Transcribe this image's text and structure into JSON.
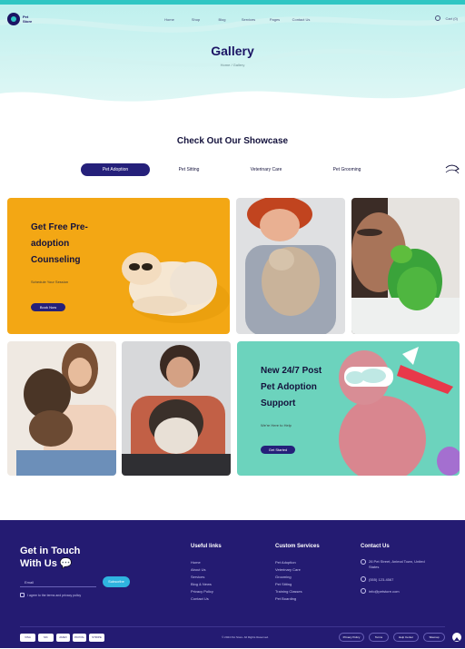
{
  "header": {
    "logo_text": "Pet Store",
    "menu": [
      "Home",
      "Shop",
      "Blog",
      "Services",
      "Pages",
      "Contact Us"
    ],
    "cart_label": "Cart (0)"
  },
  "hero": {
    "title": "Gallery",
    "breadcrumb": "Home / Gallery"
  },
  "showcase": {
    "title": "Check Out Our Showcase",
    "tabs": [
      "Pet Adoption",
      "Pet Sitting",
      "Veterinary Care",
      "Pet Grooming"
    ],
    "active_tab": 0
  },
  "promo1": {
    "title_lines": [
      "Get Free Pre-",
      "adoption",
      "Counseling"
    ],
    "subtitle": "Schedule Your Session",
    "button": "Book Now"
  },
  "promo2": {
    "title_lines": [
      "New 24/7 Post",
      "Pet Adoption",
      "Support"
    ],
    "subtitle": "We're Here to Help",
    "button": "Get Started"
  },
  "footer": {
    "get_in_touch": [
      "Get in Touch",
      "With Us 💬"
    ],
    "email_placeholder": "Email",
    "subscribe_label": "Subscribe",
    "consent_text": "I agree to the terms and privacy policy",
    "useful_links_title": "Useful links",
    "useful_links": [
      "Home",
      "About Us",
      "Services",
      "Blog & News",
      "Privacy Policy",
      "Contact Us"
    ],
    "custom_services_title": "Custom Services",
    "custom_services": [
      "Pet Adoption",
      "Veterinary Care",
      "Grooming",
      "Pet Sitting",
      "Training Classes",
      "Pet Boarding"
    ],
    "contact_title": "Contact Us",
    "contact_address": "26 Pet Street, Animal Town, United States",
    "contact_phone": "(555) 123-4567",
    "contact_email": "info@petstore.com",
    "payment_labels": [
      "VISA",
      "MC",
      "AMEX",
      "PAYPAL",
      "STRIPE"
    ],
    "copyright": "© 2024 Pet Store. All Rights Reserved.",
    "bottom_links": [
      "Privacy Policy",
      "Terms",
      "Help Center",
      "Sitemap"
    ]
  },
  "colors": {
    "brand_navy": "#241b72",
    "accent_teal": "#2fc6c3",
    "promo_orange": "#f3a714",
    "promo_mint": "#6cd3bd"
  }
}
